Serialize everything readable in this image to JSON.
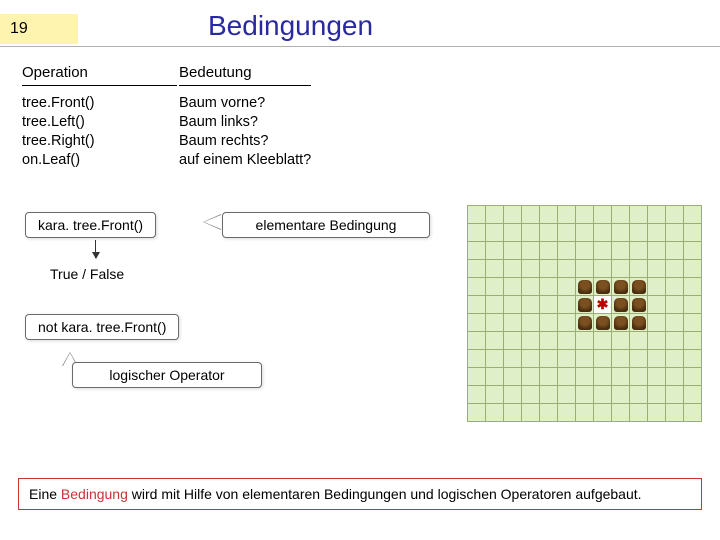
{
  "slide_number": "19",
  "title": "Bedingungen",
  "table": {
    "header_op": "Operation",
    "header_meaning": "Bedeutung",
    "ops": [
      "tree.Front()",
      "tree.Left()",
      "tree.Right()",
      "on.Leaf()"
    ],
    "meanings": [
      "Baum vorne?",
      "Baum links?",
      "Baum rechts?",
      "auf einem Kleeblatt?"
    ]
  },
  "chips": {
    "example_call": "kara. tree.Front()",
    "elementary": "elementare Bedingung",
    "true_false": "True / False",
    "not_call": "not kara. tree.Front()",
    "logical_op": "logischer Operator"
  },
  "grid": {
    "cols": 13,
    "rows": 12,
    "trees": [
      {
        "r": 4,
        "c": 6
      },
      {
        "r": 4,
        "c": 7
      },
      {
        "r": 4,
        "c": 8
      },
      {
        "r": 4,
        "c": 9
      },
      {
        "r": 5,
        "c": 6
      },
      {
        "r": 5,
        "c": 8
      },
      {
        "r": 5,
        "c": 9
      },
      {
        "r": 6,
        "c": 6
      },
      {
        "r": 6,
        "c": 7
      },
      {
        "r": 6,
        "c": 8
      },
      {
        "r": 6,
        "c": 9
      }
    ],
    "bug": {
      "r": 5,
      "c": 7,
      "glyph": "✱"
    }
  },
  "footer": {
    "pre": "Eine ",
    "kw": "Bedingung",
    "post": " wird mit Hilfe von elementaren Bedingungen und logischen Operatoren aufgebaut."
  }
}
